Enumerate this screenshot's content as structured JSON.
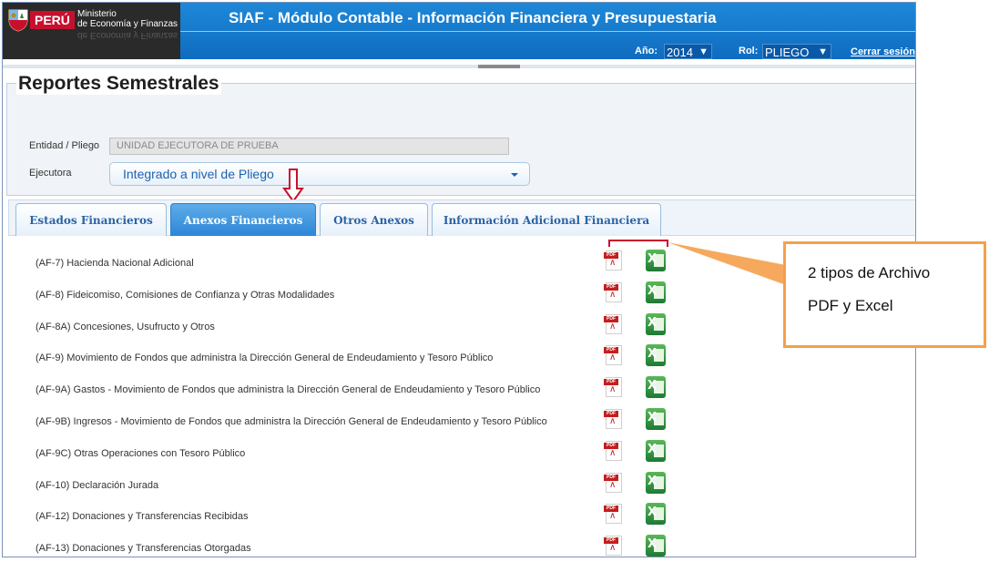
{
  "header": {
    "logo_country": "PERÚ",
    "logo_line1": "Ministerio",
    "logo_line2": "de Economía y Finanzas",
    "title": "SIAF - Módulo Contable - Información Financiera y Presupuestaria",
    "year_label": "Año:",
    "year_value": "2014",
    "role_label": "Rol:",
    "role_value": "PLIEGO",
    "logout_label": "Cerrar sesión"
  },
  "report": {
    "title": "Reportes Semestrales",
    "entity_label": "Entidad / Pliego",
    "entity_value": "UNIDAD EJECUTORA DE PRUEBA",
    "executor_label": "Ejecutora",
    "executor_value": "Integrado a nivel de Pliego"
  },
  "tabs": [
    {
      "label": "Estados Financieros",
      "active": false
    },
    {
      "label": "Anexos Financieros",
      "active": true
    },
    {
      "label": "Otros Anexos",
      "active": false
    },
    {
      "label": "Información Adicional Financiera",
      "active": false
    }
  ],
  "annexes": [
    "(AF-7) Hacienda Nacional Adicional",
    "(AF-8) Fideicomiso, Comisiones de Confianza y Otras Modalidades",
    "(AF-8A) Concesiones, Usufructo y Otros",
    "(AF-9) Movimiento de Fondos que administra la Dirección General de Endeudamiento y Tesoro Público",
    "(AF-9A) Gastos - Movimiento de Fondos que administra la Dirección General de Endeudamiento y Tesoro Público",
    "(AF-9B) Ingresos - Movimiento de Fondos que administra la Dirección General de Endeudamiento y Tesoro Público",
    "(AF-9C) Otras Operaciones con Tesoro Público",
    "(AF-10) Declaración Jurada",
    "(AF-12) Donaciones y Transferencias Recibidas",
    "(AF-13) Donaciones y Transferencias Otorgadas"
  ],
  "icons": {
    "pdf": "pdf-file-icon",
    "excel": "excel-file-icon"
  },
  "callout": {
    "line1": "2 tipos de Archivo",
    "line2": "PDF y Excel"
  },
  "colors": {
    "header_blue": "#1e88d8",
    "tab_active": "#2d86d6",
    "accent_red": "#c8102e",
    "callout_orange": "#f5a04a"
  }
}
